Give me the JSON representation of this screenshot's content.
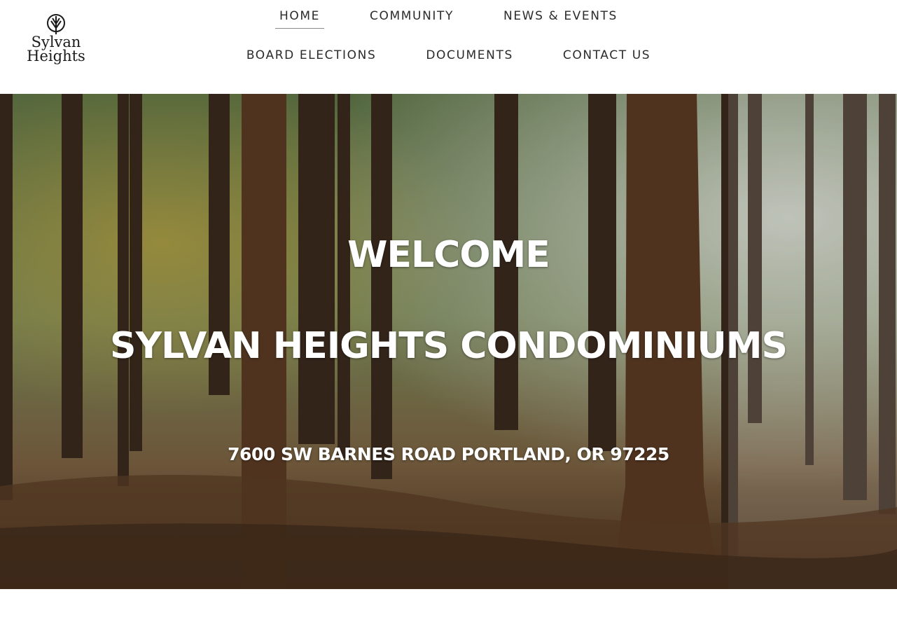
{
  "logo": {
    "line1": "Sylvan",
    "line2": "Heights"
  },
  "nav": {
    "row1": [
      "HOME",
      "COMMUNITY",
      "NEWS & EVENTS"
    ],
    "row2": [
      "BOARD ELECTIONS",
      "DOCUMENTS",
      "CONTACT US"
    ],
    "active": "HOME"
  },
  "hero": {
    "title": "WELCOME",
    "subtitle": "SYLVAN HEIGHTS CONDOMINIUMS",
    "address": "7600 SW BARNES ROAD PORTLAND, OR 97225"
  },
  "colors": {
    "nav_text": "#2b2b2b",
    "hero_text": "#ffffff",
    "background": "#ffffff"
  },
  "icons": {
    "logo_mark": "tree-icon"
  }
}
